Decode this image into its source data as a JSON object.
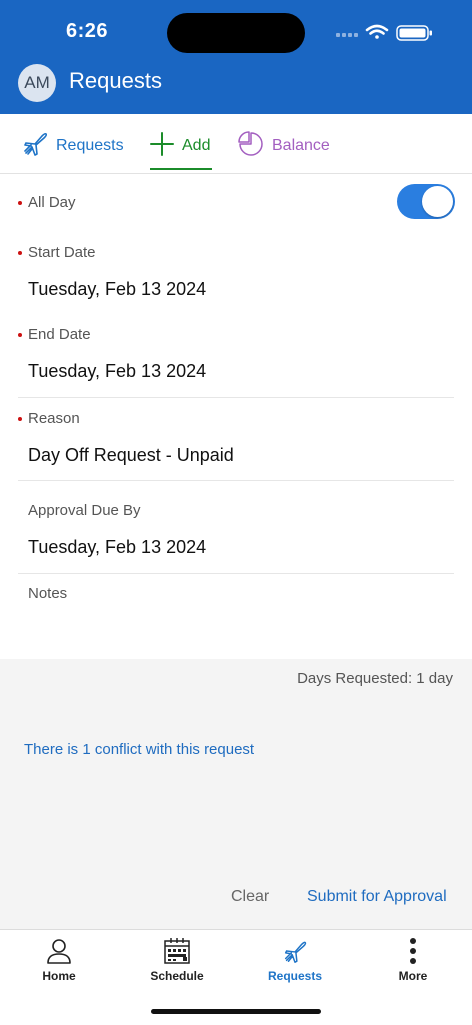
{
  "status_bar": {
    "time": "6:26"
  },
  "header": {
    "avatar_initials": "AM",
    "title": "Requests"
  },
  "tabs": [
    {
      "label": "Requests",
      "icon": "airplane-icon"
    },
    {
      "label": "Add",
      "icon": "plus-icon",
      "selected": true
    },
    {
      "label": "Balance",
      "icon": "pie-chart-icon"
    }
  ],
  "form": {
    "all_day": {
      "label": "All Day",
      "value": true
    },
    "start_date": {
      "label": "Start Date",
      "value": "Tuesday, Feb 13 2024"
    },
    "end_date": {
      "label": "End Date",
      "value": "Tuesday, Feb 13 2024"
    },
    "reason": {
      "label": "Reason",
      "value": "Day Off Request - Unpaid"
    },
    "approval_due": {
      "label": "Approval Due By",
      "value": "Tuesday, Feb 13 2024"
    },
    "notes": {
      "label": "Notes",
      "value": ""
    }
  },
  "summary": {
    "days_requested": "Days Requested: 1 day",
    "conflict_text": "There is 1 conflict with this request"
  },
  "actions": {
    "clear": "Clear",
    "submit": "Submit for Approval"
  },
  "bottom_nav": [
    {
      "label": "Home",
      "icon": "person-icon"
    },
    {
      "label": "Schedule",
      "icon": "calendar-icon"
    },
    {
      "label": "Requests",
      "icon": "airplane-icon",
      "selected": true
    },
    {
      "label": "More",
      "icon": "more-vertical-icon"
    }
  ],
  "colors": {
    "header_bg": "#1a66c2",
    "accent_blue": "#1f74c7",
    "add_green": "#1b8c2a",
    "balance_purple": "#a35fc0",
    "required_dot": "#cc1111",
    "toggle_on": "#2a7ee0"
  }
}
